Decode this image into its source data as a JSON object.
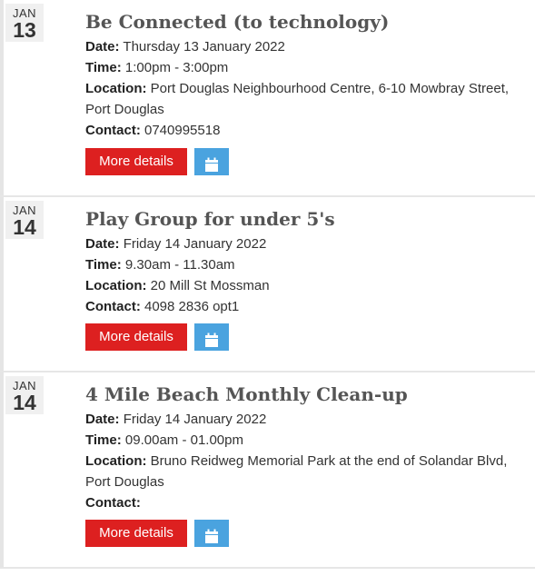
{
  "events": [
    {
      "month": "JAN",
      "day": "13",
      "title": "Be Connected (to technology)",
      "date_label": "Date:",
      "date_value": "Thursday 13 January 2022",
      "time_label": "Time:",
      "time_value": "1:00pm - 3:00pm",
      "location_label": "Location:",
      "location_value": "Port Douglas Neighbourhood Centre, 6-10 Mowbray Street, Port Douglas",
      "contact_label": "Contact:",
      "contact_value": "0740995518",
      "more_label": "More details",
      "calendar_icon": "calendar-icon"
    },
    {
      "month": "JAN",
      "day": "14",
      "title": "Play Group for under 5's",
      "date_label": "Date:",
      "date_value": "Friday 14 January 2022",
      "time_label": "Time:",
      "time_value": "9.30am - 11.30am",
      "location_label": "Location:",
      "location_value": "20 Mill St Mossman",
      "contact_label": "Contact:",
      "contact_value": "4098 2836 opt1",
      "more_label": "More details",
      "calendar_icon": "calendar-icon"
    },
    {
      "month": "JAN",
      "day": "14",
      "title": "4 Mile Beach Monthly Clean-up",
      "date_label": "Date:",
      "date_value": "Friday 14 January 2022",
      "time_label": "Time:",
      "time_value": "09.00am - 01.00pm",
      "location_label": "Location:",
      "location_value": "Bruno Reidweg Memorial Park at the end of Solandar Blvd, Port Douglas",
      "contact_label": "Contact:",
      "contact_value": "",
      "more_label": "More details",
      "calendar_icon": "calendar-icon"
    }
  ],
  "colors": {
    "more_button": "#dd2020",
    "calendar_button": "#4aa3df",
    "date_box": "#f0f0f0",
    "title": "#555555"
  }
}
